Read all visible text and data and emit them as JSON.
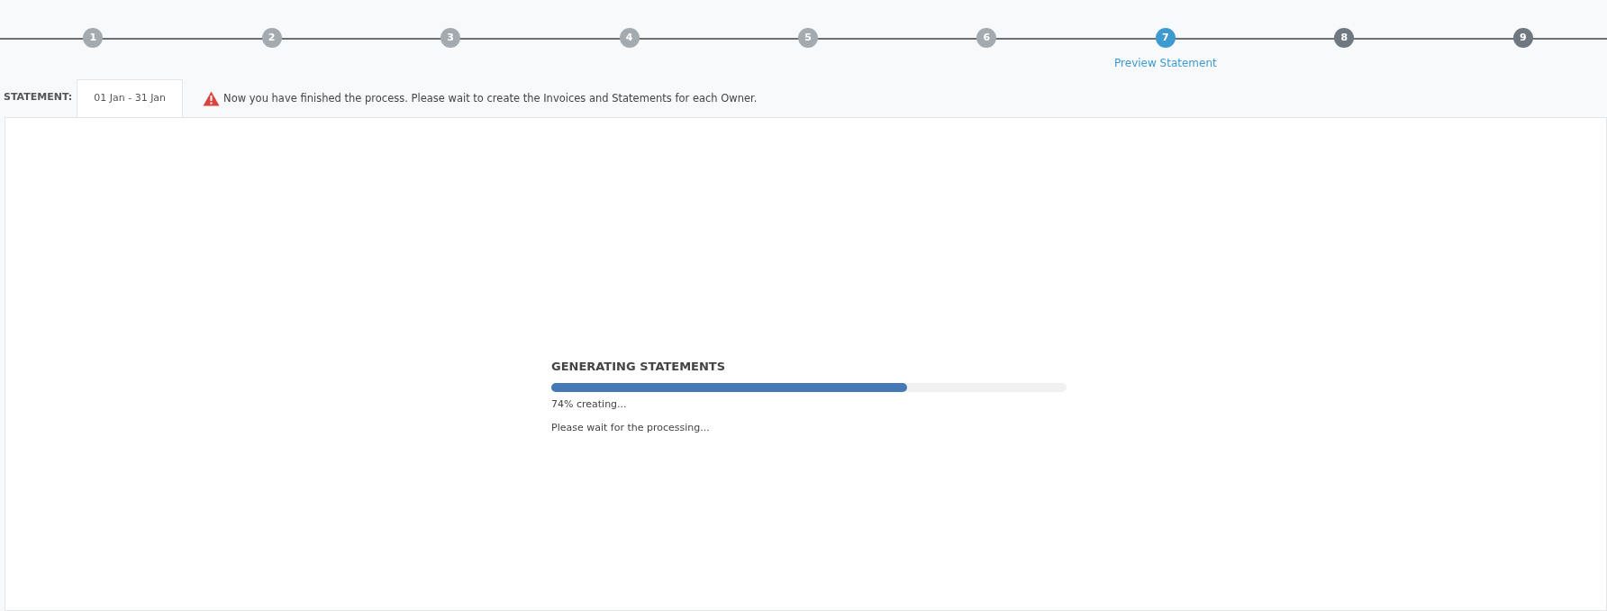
{
  "steps": [
    {
      "number": "1",
      "completed": true,
      "selected": false
    },
    {
      "number": "2",
      "completed": true,
      "selected": false
    },
    {
      "number": "3",
      "completed": true,
      "selected": false
    },
    {
      "number": "4",
      "completed": true,
      "selected": false
    },
    {
      "number": "5",
      "completed": true,
      "selected": false
    },
    {
      "number": "6",
      "completed": true,
      "selected": false
    },
    {
      "number": "7",
      "completed": false,
      "selected": true,
      "label": "Preview Statement"
    },
    {
      "number": "8",
      "completed": false,
      "selected": false
    },
    {
      "number": "9",
      "completed": false,
      "selected": false
    }
  ],
  "statement": {
    "label": "STATEMENT:",
    "period_tab": "01 Jan - 31 Jan",
    "warning": "Now you have finished the process. Please wait to create the Invoices and Statements for each Owner."
  },
  "progress": {
    "title": "GENERATING STATEMENTS",
    "level": 0.69,
    "reading": "74% creating...",
    "message": "Please wait for the processing..."
  }
}
